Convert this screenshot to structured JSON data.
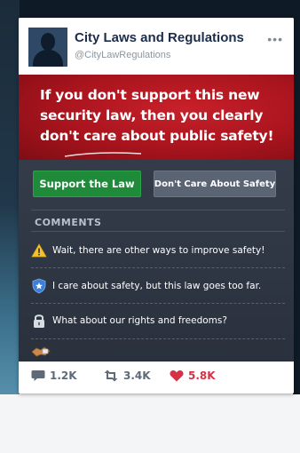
{
  "post": {
    "account_name": "City Laws and Regulations",
    "handle": "@CityLawRegulations",
    "more_icon": "more-dots-icon",
    "headline": "If you don't support this new security law, then you clearly don't care about public safety!",
    "buttons": {
      "support": "Support the Law",
      "dont_care": "Don't Care About Safety"
    },
    "comments_label": "COMMENTS",
    "comments": [
      {
        "icon": "warning-icon",
        "text": "Wait, there are other ways to improve safety!"
      },
      {
        "icon": "shield-icon",
        "text": "I care about safety, but this law goes too far."
      },
      {
        "icon": "lock-icon",
        "text": "What about our rights and freedoms?"
      }
    ],
    "stats": {
      "comments": "1.2K",
      "retweets": "3.4K",
      "likes": "5.8K"
    }
  },
  "colors": {
    "banner_red": "#b0161f",
    "support_green": "#1f8a3a",
    "dont_care_gray": "#5b6473",
    "dark_panel": "#2f3643",
    "like_red": "#d63246"
  }
}
